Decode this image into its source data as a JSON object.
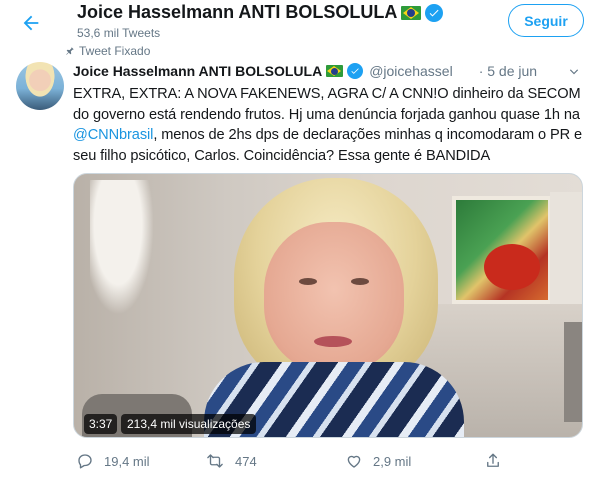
{
  "header": {
    "title": "Joice Hasselmann ANTI BOLSOLULA",
    "tweet_count": "53,6 mil Tweets",
    "follow_label": "Seguir",
    "icons": {
      "back": "back-arrow-icon",
      "flag": "brazil-flag-icon",
      "verified": "verified-badge-icon"
    }
  },
  "tweet": {
    "pinned_label": "Tweet Fixado",
    "author_name": "Joice Hasselmann ANTI BOLSOLULA",
    "handle": "@joicehassel",
    "date": "· 5 de jun",
    "text_part1": "EXTRA, EXTRA: A NOVA FAKENEWS, AGRA C/ A CNN!O dinheiro da SECOM do governo está rendendo frutos. Hj uma denúncia forjada ganhou quase 1h na ",
    "mention": "@CNNbrasil",
    "text_part2": ", menos de 2hs  dps de declarações minhas q incomodaram o PR e seu filho psicótico, Carlos. Coincidência? Essa gente é BANDIDA",
    "video": {
      "duration": "3:37",
      "views": "213,4 mil visualizações"
    },
    "actions": {
      "replies": "19,4 mil",
      "retweets": "474",
      "likes": "2,9 mil"
    }
  },
  "colors": {
    "accent": "#1da1f2",
    "text": "#14171a",
    "secondary": "#657786"
  }
}
